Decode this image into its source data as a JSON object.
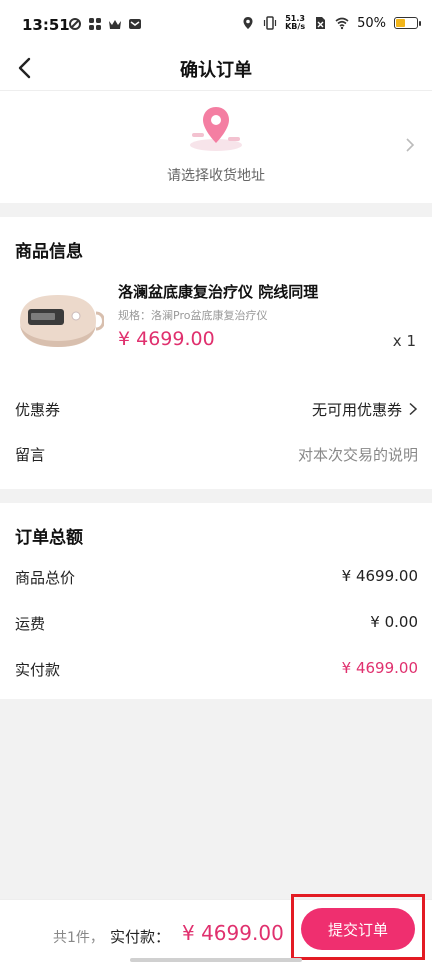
{
  "status_bar": {
    "time": "13:51",
    "net_speed_value": "51.3",
    "net_speed_unit": "KB/s",
    "battery": "50%",
    "battery_level": 0.5
  },
  "header": {
    "title": "确认订单",
    "back_icon": "chevron-left-icon"
  },
  "address": {
    "placeholder": "请选择收货地址",
    "icon": "location-pin-icon"
  },
  "product_section": {
    "title": "商品信息",
    "product": {
      "name": "洛澜盆底康复治疗仪 院线同理",
      "spec": "规格：洛澜Pro盆底康复治疗仪",
      "price": "¥ 4699.00",
      "quantity": "x 1"
    },
    "coupon": {
      "label": "优惠券",
      "value": "无可用优惠券"
    },
    "message": {
      "label": "留言",
      "placeholder": "对本次交易的说明"
    }
  },
  "order_total": {
    "title": "订单总额",
    "rows": [
      {
        "label": "商品总价",
        "value": "¥ 4699.00"
      },
      {
        "label": "运费",
        "value": "¥ 0.00"
      },
      {
        "label": "实付款",
        "value": "¥ 4699.00"
      }
    ]
  },
  "bottom_bar": {
    "count": "共1件，",
    "pay_label": "实付款：",
    "total": "¥ 4699.00",
    "submit_label": "提交订单"
  },
  "colors": {
    "accent": "#e0306e",
    "button": "#ef2f6f",
    "highlight_border": "#e31b23"
  }
}
